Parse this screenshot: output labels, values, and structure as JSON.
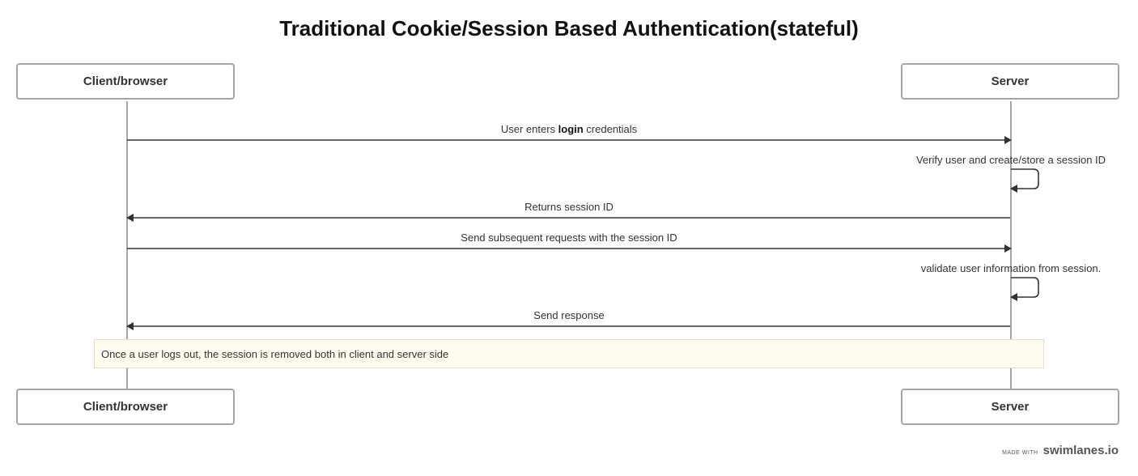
{
  "diagram": {
    "title": "Traditional Cookie/Session Based Authentication(stateful)",
    "actors": {
      "client": "Client/browser",
      "server": "Server"
    },
    "messages": [
      {
        "from": "client",
        "to": "server",
        "label_before": "User enters ",
        "label_bold": "login",
        "label_after": " credentials"
      },
      {
        "from": "server",
        "to": "server",
        "label": "Verify user and create/store a session ID"
      },
      {
        "from": "server",
        "to": "client",
        "label": "Returns session ID"
      },
      {
        "from": "client",
        "to": "server",
        "label": "Send subsequent requests with the session ID"
      },
      {
        "from": "server",
        "to": "server",
        "label": "validate user information from session."
      },
      {
        "from": "server",
        "to": "client",
        "label": "Send response"
      }
    ],
    "note": "Once a user logs out, the session is removed both in client and server side",
    "footer": {
      "made_with": "MADE WITH",
      "brand": "swimlanes.io"
    }
  }
}
